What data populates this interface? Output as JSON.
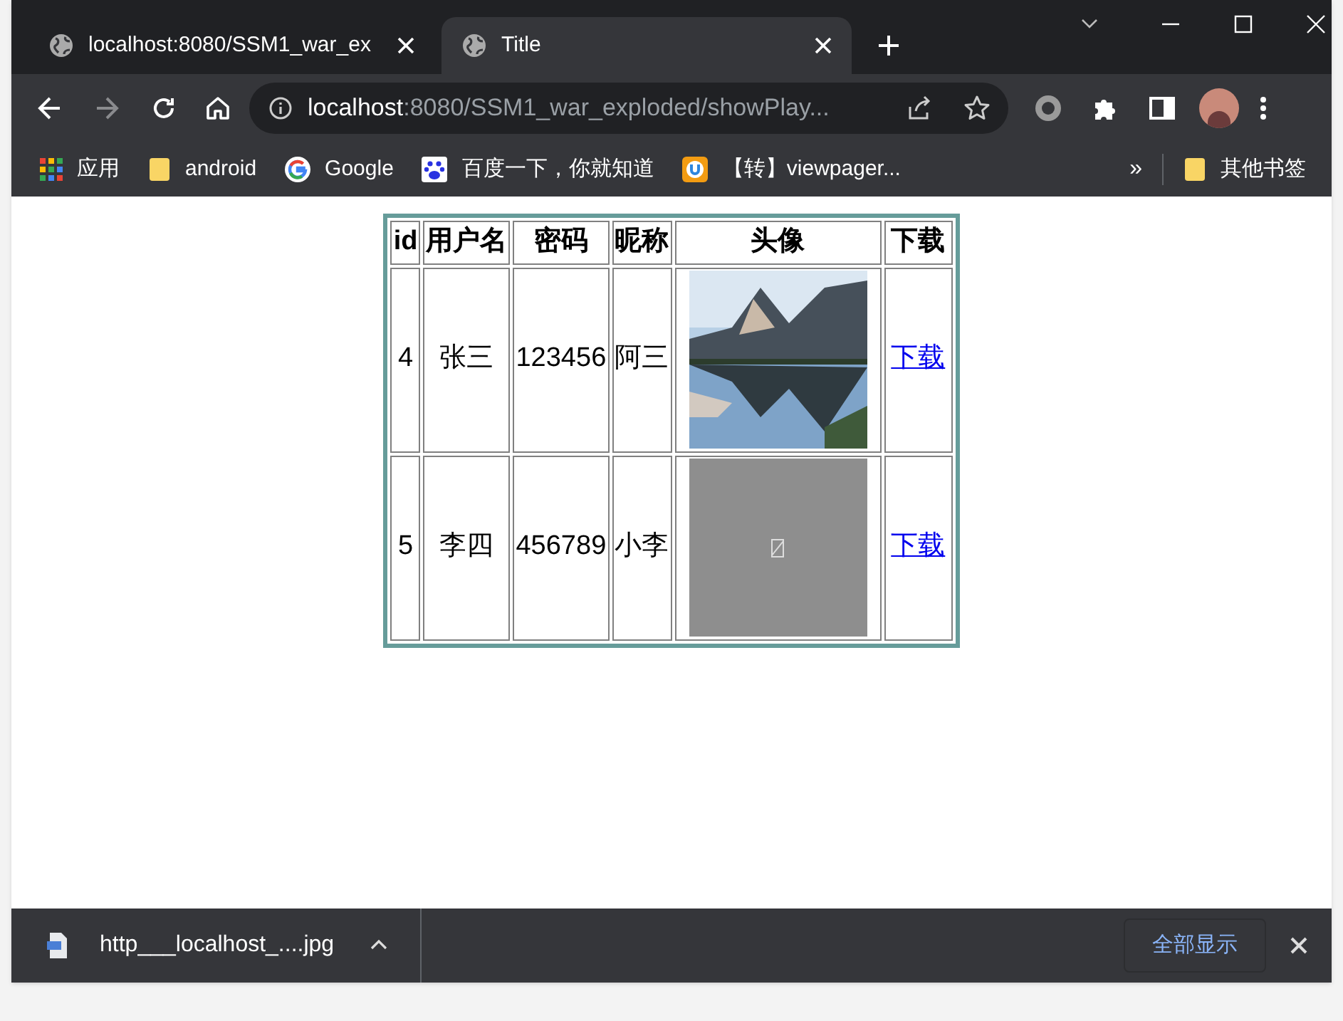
{
  "tabs": [
    {
      "title": "localhost:8080/SSM1_war_ex",
      "selected": false
    },
    {
      "title": "Title",
      "selected": true
    }
  ],
  "address_bar": {
    "host": "localhost",
    "path": ":8080/SSM1_war_exploded/showPlay..."
  },
  "bookmarks": [
    {
      "label": "应用",
      "kind": "apps"
    },
    {
      "label": "android",
      "kind": "folder"
    },
    {
      "label": "Google",
      "kind": "google"
    },
    {
      "label": "百度一下，你就知道",
      "kind": "baidu"
    },
    {
      "label": "【转】viewpager...",
      "kind": "site"
    }
  ],
  "bookmarks_overflow": "»",
  "other_bookmarks": "其他书签",
  "table": {
    "columns": [
      "id",
      "用户名",
      "密码",
      "昵称",
      "头像",
      "下载"
    ],
    "rows": [
      {
        "id": "4",
        "username": "张三",
        "password": "123456",
        "nickname": "阿三",
        "download": "下载"
      },
      {
        "id": "5",
        "username": "李四",
        "password": "456789",
        "nickname": "小李",
        "avatar": {
          "kind": "broken"
        },
        "download": "下载"
      }
    ]
  },
  "downloads": {
    "file": "http___localhost_....jpg",
    "show_all": "全部显示"
  }
}
